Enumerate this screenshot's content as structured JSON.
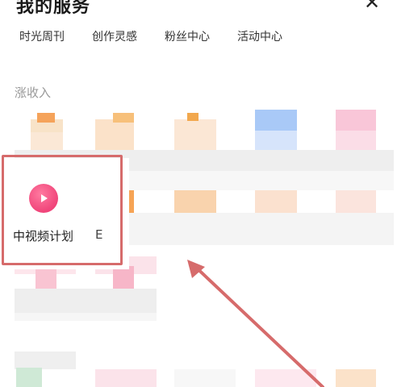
{
  "header": {
    "title": "我的服务",
    "close_icon": "close-icon"
  },
  "tabs": [
    {
      "label": "时光周刊"
    },
    {
      "label": "创作灵感"
    },
    {
      "label": "粉丝中心"
    },
    {
      "label": "活动中心"
    }
  ],
  "section": {
    "title": "涨收入"
  },
  "highlighted_service": {
    "label": "中视频计划",
    "icon": "play-icon",
    "icon_color": "#f0457a"
  },
  "overlap_char": "E",
  "colors": {
    "annotation": "#d66b6b"
  }
}
